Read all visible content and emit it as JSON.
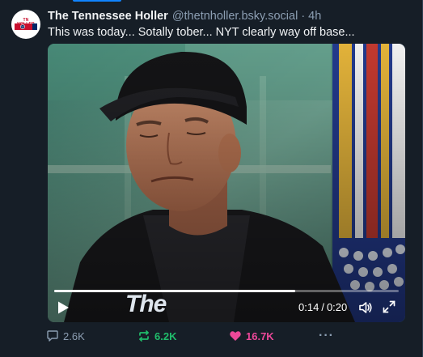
{
  "post": {
    "avatar_text": "TN HOLLER",
    "display_name": "The Tennessee Holler",
    "handle": "@thetnholler.bsky.social",
    "separator": "·",
    "time": "4h",
    "text": "This was today... Sotally tober... NYT clearly way off base..."
  },
  "video": {
    "current_time": "0:14",
    "separator": "/",
    "duration": "0:20",
    "progress": 0.7,
    "shirt_text": "The"
  },
  "actions": {
    "reply_count": "2.6K",
    "repost_count": "6.2K",
    "like_count": "16.7K",
    "more_label": "···"
  },
  "colors": {
    "background": "#161e27",
    "primary_text": "#f1f3f5",
    "secondary_text": "#8c9eb2",
    "repost": "#20bc6b",
    "like": "#ec4899",
    "accent": "#1083fe"
  }
}
